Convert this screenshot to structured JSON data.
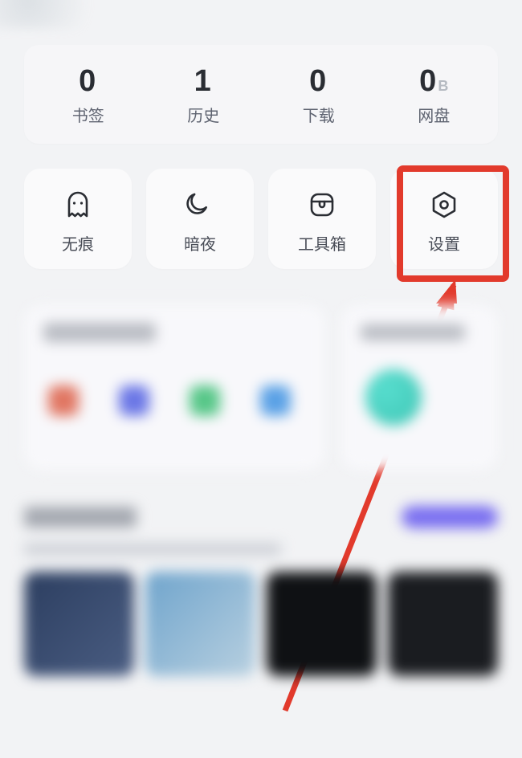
{
  "stats": [
    {
      "value": "0",
      "label": "书签",
      "suffix": ""
    },
    {
      "value": "1",
      "label": "历史",
      "suffix": ""
    },
    {
      "value": "0",
      "label": "下载",
      "suffix": ""
    },
    {
      "value": "0",
      "label": "网盘",
      "suffix": "B"
    }
  ],
  "tools": [
    {
      "icon": "ghost-icon",
      "label": "无痕"
    },
    {
      "icon": "moon-icon",
      "label": "暗夜"
    },
    {
      "icon": "toolbox-icon",
      "label": "工具箱"
    },
    {
      "icon": "settings-icon",
      "label": "设置"
    }
  ],
  "annotation": {
    "highlight_target": "settings",
    "color": "#e23a2c"
  }
}
